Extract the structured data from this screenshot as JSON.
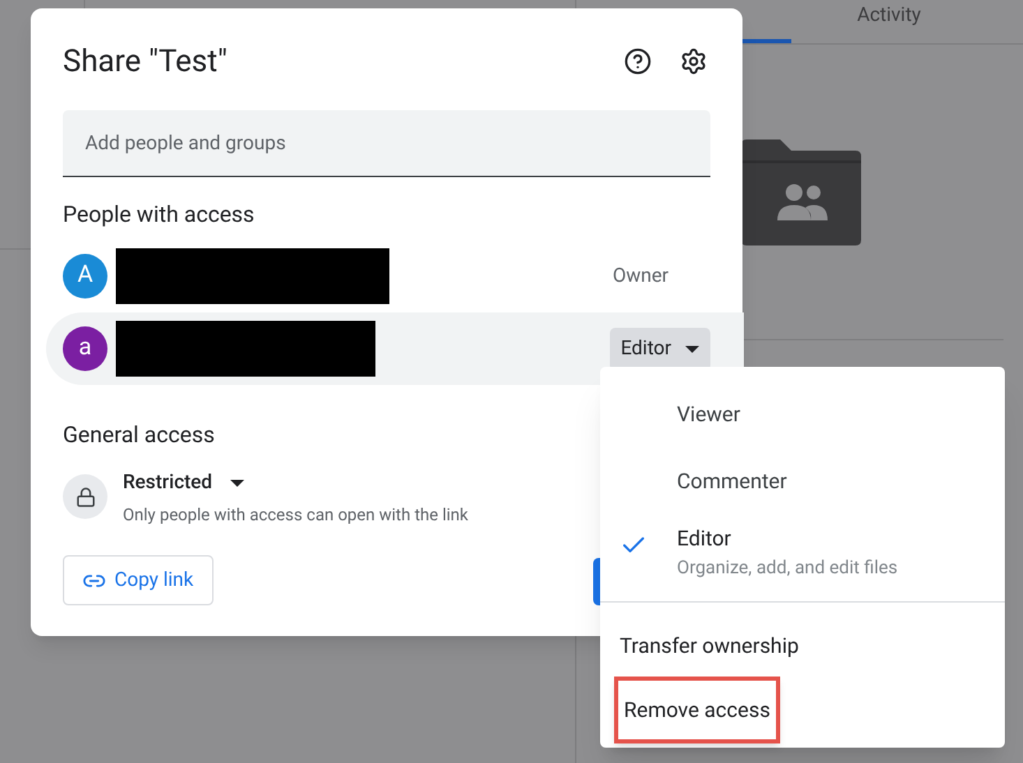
{
  "background": {
    "tabs": [
      {
        "label": "Activity",
        "selected": false
      }
    ]
  },
  "dialog": {
    "title": "Share \"Test\"",
    "search": {
      "placeholder": "Add people and groups"
    },
    "people_heading": "People with access",
    "people": [
      {
        "avatar": "A",
        "color": "#1a8bd6",
        "role": "Owner",
        "kind": "label",
        "highlighted": false
      },
      {
        "avatar": "a",
        "color": "#7b1fa2",
        "role": "Editor",
        "kind": "dropdown",
        "highlighted": true
      }
    ],
    "general_heading": "General access",
    "general": {
      "setting": "Restricted",
      "description": "Only people with access can open with the link"
    },
    "copy_link": "Copy link"
  },
  "menu": {
    "roles": [
      {
        "label": "Viewer",
        "selected": false
      },
      {
        "label": "Commenter",
        "selected": false
      },
      {
        "label": "Editor",
        "description": "Organize, add, and edit files",
        "selected": true
      }
    ],
    "actions": [
      {
        "label": "Transfer ownership",
        "highlighted": false
      },
      {
        "label": "Remove access",
        "highlighted": true
      }
    ]
  }
}
